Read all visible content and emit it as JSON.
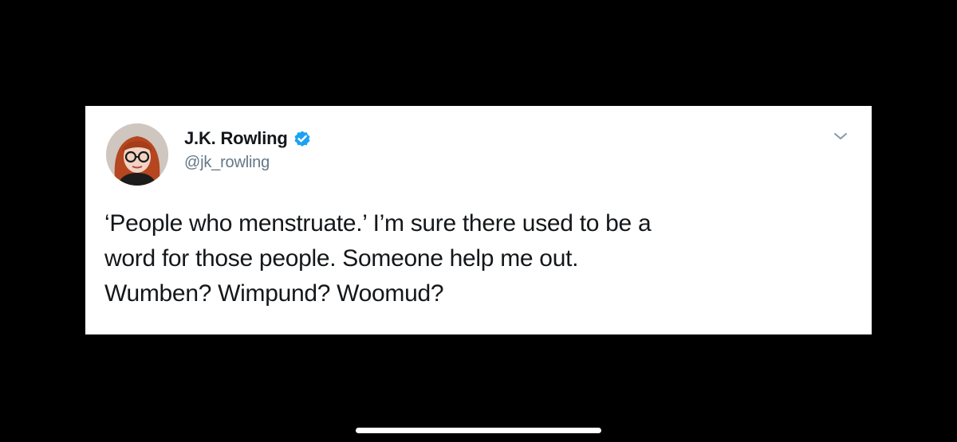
{
  "tweet": {
    "author": {
      "display_name": "J.K. Rowling",
      "handle": "@jk_rowling",
      "verified": true,
      "avatar_icon": "profile-photo"
    },
    "text_lines": [
      "‘People who menstruate.’ I’m sure there used to be a",
      "word for those people. Someone help me out.",
      "Wumben? Wimpund? Woomud?"
    ],
    "menu_icon": "chevron-down-icon"
  },
  "colors": {
    "background": "#000000",
    "card": "#ffffff",
    "text": "#14171a",
    "secondary_text": "#657786",
    "verified_badge": "#1da1f2"
  }
}
